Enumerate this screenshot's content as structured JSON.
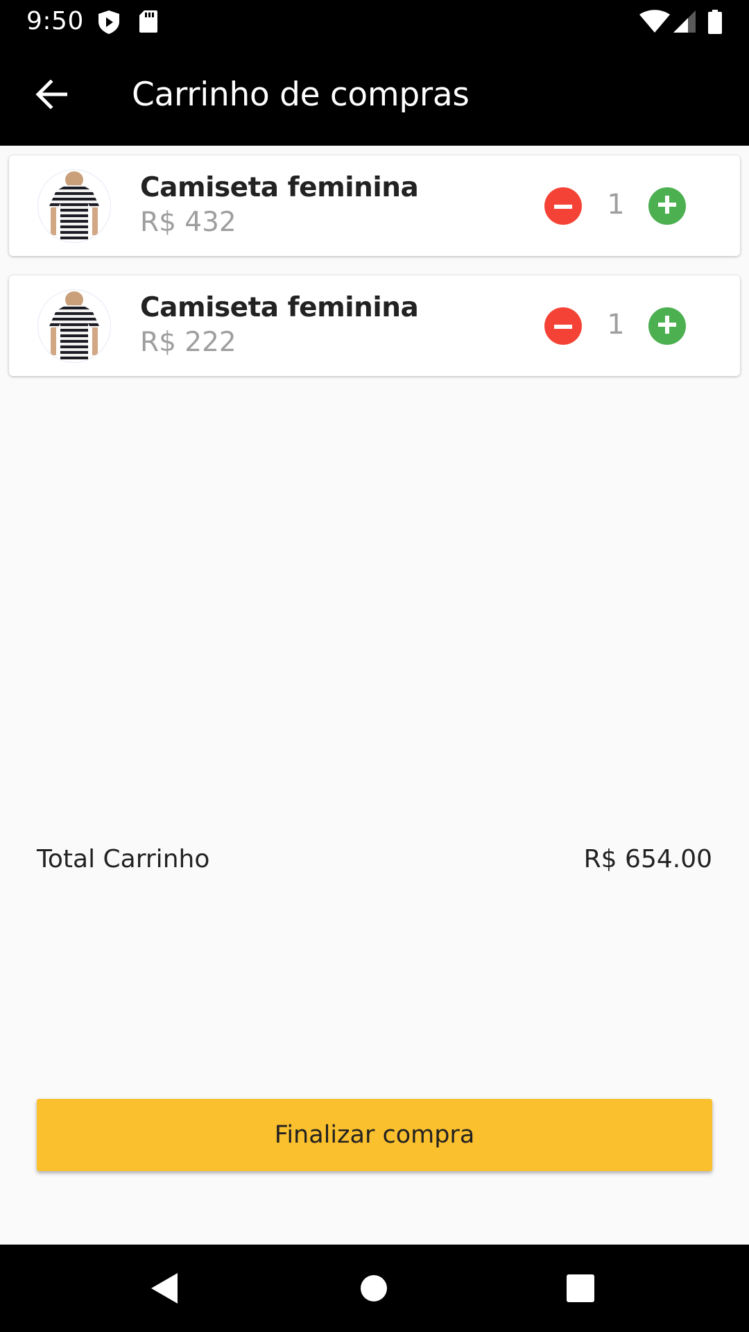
{
  "status_bar": {
    "time": "9:50",
    "icons": [
      "shield-play-icon",
      "sd-card-icon",
      "wifi-icon",
      "signal-icon",
      "battery-icon"
    ]
  },
  "app_bar": {
    "title": "Carrinho de compras",
    "back_icon": "arrow-back-icon"
  },
  "cart": {
    "items": [
      {
        "name": "Camiseta feminina",
        "price": "R$ 432",
        "quantity": "1"
      },
      {
        "name": "Camiseta feminina",
        "price": "R$ 222",
        "quantity": "1"
      }
    ]
  },
  "total": {
    "label": "Total Carrinho",
    "value": "R$ 654.00"
  },
  "checkout": {
    "label": "Finalizar compra"
  },
  "colors": {
    "app_bar": "#000000",
    "minus": "#f44336",
    "plus": "#4caf50",
    "checkout": "#fbc02d"
  },
  "nav_bar": {
    "icons": [
      "back-triangle-icon",
      "home-circle-icon",
      "recents-square-icon"
    ]
  }
}
